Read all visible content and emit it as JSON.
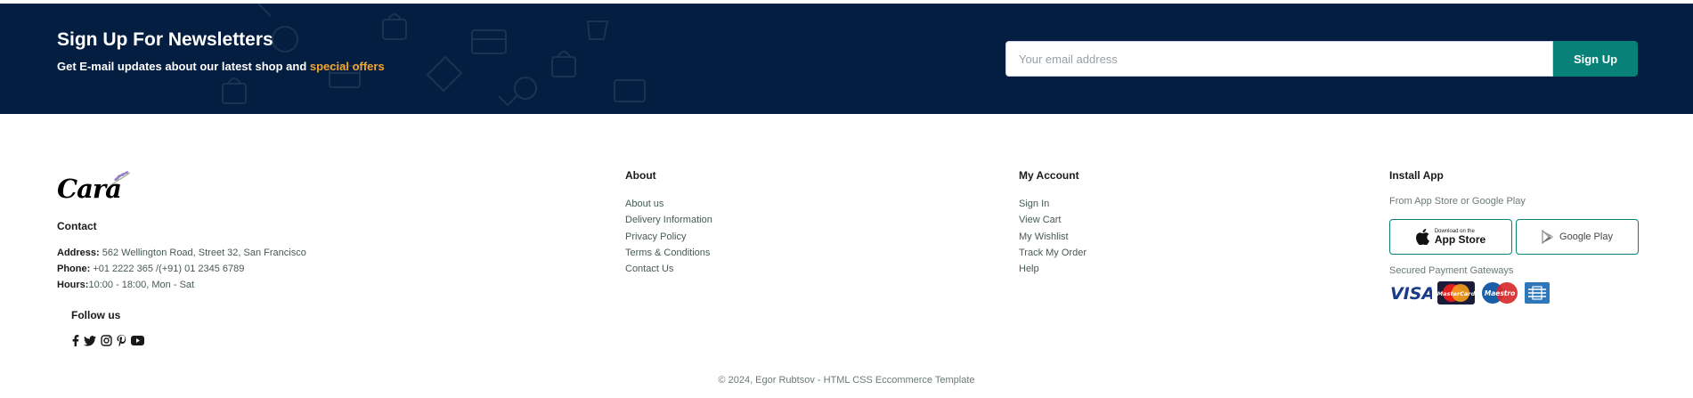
{
  "newsletter": {
    "title": "Sign Up For Newsletters",
    "subtitle_prefix": "Get E-mail updates about our latest shop and",
    "subtitle_accent": "special offers",
    "email_placeholder": "Your email address",
    "email_value": "",
    "button_label": "Sign Up",
    "accent_color": "#f4a52d",
    "background_color": "#041e42",
    "button_color": "#088178"
  },
  "brand": {
    "logo_text": "Cara"
  },
  "contact": {
    "heading": "Contact",
    "address_label": "Address:",
    "address_value": " 562 Wellington Road, Street 32, San Francisco",
    "phone_label": "Phone:",
    "phone_value": " +01 2222 365 /(+91) 01 2345 6789",
    "hours_label": "Hours:",
    "hours_value": "10:00 - 18:00, Mon - Sat",
    "follow_heading": "Follow us",
    "social_icons": [
      "facebook-icon",
      "twitter-icon",
      "instagram-icon",
      "pinterest-icon",
      "youtube-icon"
    ]
  },
  "about": {
    "heading": "About",
    "links": [
      "About us",
      "Delivery Information",
      "Privacy Policy",
      "Terms & Conditions",
      "Contact Us"
    ]
  },
  "account": {
    "heading": "My Account",
    "links": [
      "Sign In",
      "View Cart",
      "My Wishlist",
      "Track My Order",
      "Help"
    ]
  },
  "install": {
    "heading": "Install App",
    "subtitle": "From App Store or Google Play",
    "app_store_small": "Download on the",
    "app_store_big": "App Store",
    "google_play": "Google Play",
    "payment_heading": "Secured Payment Gateways",
    "payment_icons": [
      "visa-icon",
      "mastercard-icon",
      "maestro-icon",
      "amex-icon"
    ],
    "visa_text": "VISA",
    "mastercard_text": "MasterCard",
    "maestro_text": "Maestro"
  },
  "footer": {
    "copyright": "© 2024, Egor Rubtsov - HTML CSS Eccommerce Template"
  }
}
